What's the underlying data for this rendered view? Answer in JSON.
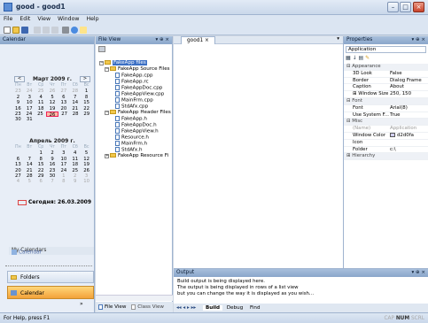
{
  "window": {
    "title": "good - good1"
  },
  "menu": [
    "File",
    "Edit",
    "View",
    "Window",
    "Help"
  ],
  "calendar": {
    "header": "Calendar",
    "month1": {
      "title": "Март 2009 г.",
      "weekdays": [
        "Пн",
        "Вт",
        "Ср",
        "Чт",
        "Пт",
        "Сб",
        "Вс"
      ],
      "rows": [
        [
          "23",
          "24",
          "25",
          "26",
          "27",
          "28",
          "1"
        ],
        [
          "2",
          "3",
          "4",
          "5",
          "6",
          "7",
          "8"
        ],
        [
          "9",
          "10",
          "11",
          "12",
          "13",
          "14",
          "15"
        ],
        [
          "16",
          "17",
          "18",
          "19",
          "20",
          "21",
          "22"
        ],
        [
          "23",
          "24",
          "25",
          "26",
          "27",
          "28",
          "29"
        ],
        [
          "30",
          "31",
          "",
          "",
          "",
          "",
          ""
        ]
      ]
    },
    "month2": {
      "title": "Апрель 2009 г.",
      "weekdays": [
        "Пн",
        "Вт",
        "Ср",
        "Чт",
        "Пт",
        "Сб",
        "Вс"
      ],
      "rows": [
        [
          "",
          "",
          "1",
          "2",
          "3",
          "4",
          "5"
        ],
        [
          "6",
          "7",
          "8",
          "9",
          "10",
          "11",
          "12"
        ],
        [
          "13",
          "14",
          "15",
          "16",
          "17",
          "18",
          "19"
        ],
        [
          "20",
          "21",
          "22",
          "23",
          "24",
          "25",
          "26"
        ],
        [
          "27",
          "28",
          "29",
          "30",
          "1",
          "2",
          "3"
        ],
        [
          "4",
          "5",
          "6",
          "7",
          "8",
          "9",
          "10"
        ]
      ]
    },
    "today": "Сегодня: 26.03.2009",
    "my_calendars": "My Calendars",
    "calendar_item": "Calendar",
    "nav_folders": "Folders",
    "nav_calendar": "Calendar"
  },
  "fileview": {
    "header": "File View",
    "root": "FakeApp files",
    "src_folder": "FakeApp Source Files",
    "src": [
      "FakeApp.cpp",
      "FakeApp.rc",
      "FakeAppDoc.cpp",
      "FakeAppView.cpp",
      "MainFrm.cpp",
      "StdAfx.cpp"
    ],
    "hdr_folder": "FakeApp Header Files",
    "hdr": [
      "FakeApp.h",
      "FakeAppDoc.h",
      "FakeAppView.h",
      "Resource.h",
      "MainFrm.h",
      "StdAfx.h"
    ],
    "res_folder": "FakeApp Resource Fi",
    "tab_file": "File View",
    "tab_class": "Class View"
  },
  "document": {
    "tab": "good1"
  },
  "properties": {
    "header": "Properties",
    "object": "Application",
    "rows": [
      {
        "type": "cat",
        "k": "Appearance"
      },
      {
        "k": "3D Look",
        "v": "False"
      },
      {
        "k": "Border",
        "v": "Dialog Frame"
      },
      {
        "k": "Caption",
        "v": "About"
      },
      {
        "k": "Window Size",
        "v": "250, 150",
        "exp": "⊞"
      },
      {
        "type": "cat",
        "k": "Font"
      },
      {
        "k": "Font",
        "v": "Arial(8)"
      },
      {
        "k": "Use System F...",
        "v": "True"
      },
      {
        "type": "cat",
        "k": "Misc"
      },
      {
        "k": "(Name)",
        "v": "Application",
        "dim": true
      },
      {
        "k": "Window Color",
        "v": "d2d0fa",
        "swatch": "#d2d0fa"
      },
      {
        "k": "Icon",
        "v": ""
      },
      {
        "k": "Folder",
        "v": "c:\\"
      },
      {
        "type": "cat",
        "k": "Hierarchy",
        "exp": "⊞"
      }
    ]
  },
  "output": {
    "header": "Output",
    "lines": [
      "Build output is being displayed here.",
      "The output is being displayed in rows of a list view",
      "but you can change the way it is displayed as you wish..."
    ],
    "tabs": [
      "Build",
      "Debug",
      "Find"
    ]
  },
  "status": {
    "text": "For Help, press F1",
    "indicators": [
      "CAP",
      "NUM",
      "SCRL"
    ]
  }
}
